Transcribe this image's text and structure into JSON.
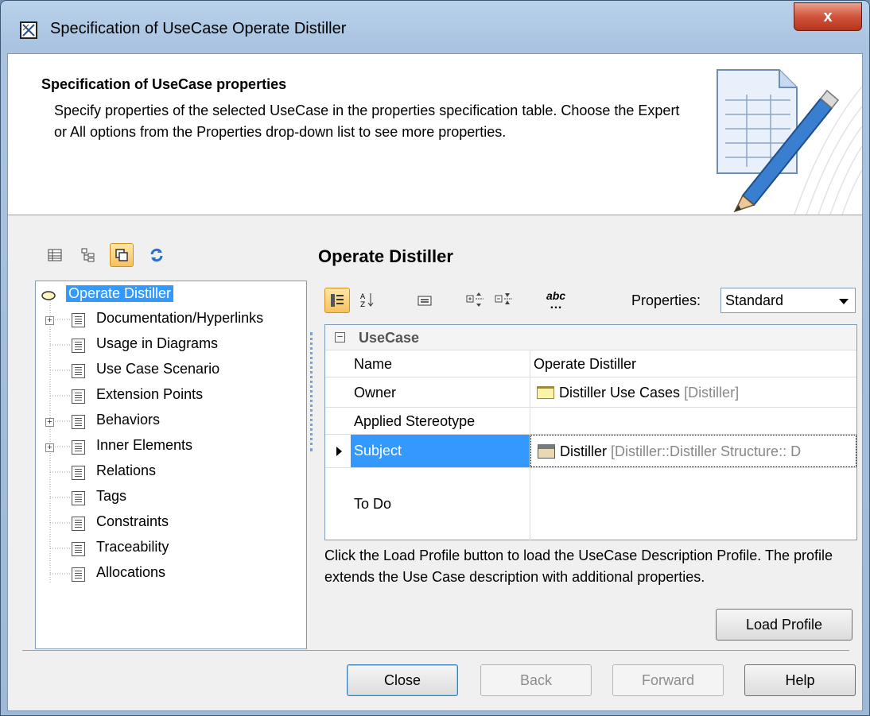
{
  "window": {
    "title": "Specification of UseCase Operate Distiller",
    "close_label": "x"
  },
  "header": {
    "title": "Specification of UseCase properties",
    "description": "Specify properties of the selected UseCase in the properties specification table. Choose the Expert or All options from the Properties drop-down list to see more properties."
  },
  "left_toolbar": {
    "icons": [
      "table-view-icon",
      "tree-view-icon",
      "copy-icon",
      "refresh-icon"
    ]
  },
  "tree": {
    "root": "Operate Distiller",
    "items": [
      {
        "label": "Documentation/Hyperlinks",
        "expandable": true
      },
      {
        "label": "Usage in Diagrams",
        "expandable": false
      },
      {
        "label": "Use Case Scenario",
        "expandable": false
      },
      {
        "label": "Extension Points",
        "expandable": false
      },
      {
        "label": "Behaviors",
        "expandable": true
      },
      {
        "label": "Inner Elements",
        "expandable": true
      },
      {
        "label": "Relations",
        "expandable": false
      },
      {
        "label": "Tags",
        "expandable": false
      },
      {
        "label": "Constraints",
        "expandable": false
      },
      {
        "label": "Traceability",
        "expandable": false
      },
      {
        "label": "Allocations",
        "expandable": false
      }
    ]
  },
  "main": {
    "element_title": "Operate Distiller",
    "properties_label": "Properties:",
    "properties_value": "Standard",
    "abc_label": "abc",
    "table": {
      "group": "UseCase",
      "rows": [
        {
          "name": "Name",
          "value": "Operate Distiller",
          "value_extra": ""
        },
        {
          "name": "Owner",
          "value": "Distiller Use Cases",
          "value_extra": "[Distiller]"
        },
        {
          "name": "Applied Stereotype",
          "value": "",
          "value_extra": ""
        },
        {
          "name": "Subject",
          "value": "Distiller",
          "value_extra": "[Distiller::Distiller Structure:: D"
        },
        {
          "name": "To Do",
          "value": "",
          "value_extra": ""
        }
      ]
    },
    "info_text": "Click the Load Profile button to load the UseCase Description Profile. The profile extends the Use Case description with additional properties.",
    "load_profile_label": "Load Profile"
  },
  "footer": {
    "close_label": "Close",
    "back_label": "Back",
    "forward_label": "Forward",
    "help_label": "Help"
  }
}
